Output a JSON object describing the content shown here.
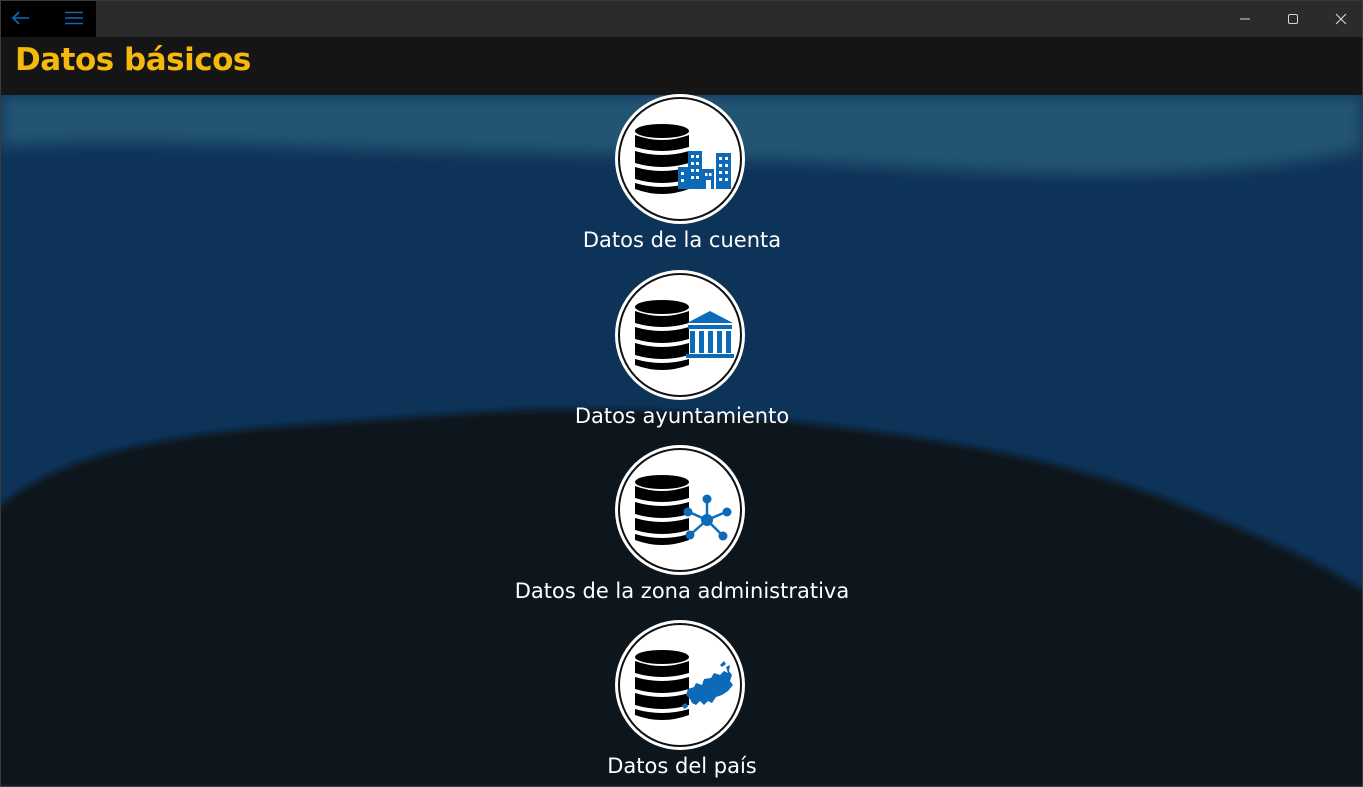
{
  "titlebar": {
    "back_icon": "arrow-left-icon",
    "menu_icon": "hamburger-menu-icon",
    "minimize_icon": "minimize-icon",
    "maximize_icon": "maximize-icon",
    "close_icon": "close-icon"
  },
  "header": {
    "title": "Datos básicos",
    "title_color": "#f5b80c"
  },
  "tiles": [
    {
      "label": "Datos de la cuenta",
      "icon": "database-buildings-icon"
    },
    {
      "label": "Datos ayuntamiento",
      "icon": "database-townhall-icon"
    },
    {
      "label": "Datos de la zona administrativa",
      "icon": "database-network-icon"
    },
    {
      "label": "Datos del país",
      "icon": "database-map-icon"
    }
  ],
  "colors": {
    "accent_blue": "#0c6ab8",
    "background_blue": "#0e3358",
    "background_dark": "#0f1318"
  }
}
